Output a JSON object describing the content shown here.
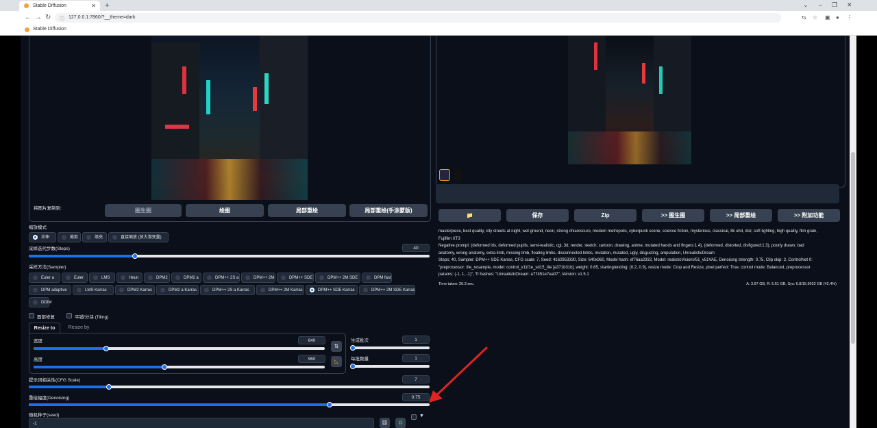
{
  "browser": {
    "tab_title": "Stable Diffusion",
    "url": "127.0.0.1:7860/?__theme=dark",
    "bookmark": "Stable Diffusion"
  },
  "left": {
    "paste_label": "将图片复制到:",
    "copy_buttons": [
      "图生图",
      "绘图",
      "局部重绘",
      "局部重绘(手涂蒙版)"
    ],
    "resize_mode_label": "缩放模式",
    "resize_modes": [
      "拉伸",
      "裁剪",
      "填充",
      "直接缩放 (放大潜变量)"
    ],
    "steps_label": "采样迭代步数(Steps)",
    "steps": "40",
    "sampler_label": "采样方法(Sampler)",
    "samplers_row1": [
      "Euler a",
      "Euler",
      "LMS",
      "Heun",
      "DPM2",
      "DPM2 a",
      "DPM++ 2S a",
      "DPM++ 2M",
      "DPM++ SDE",
      "DPM++ 2M SDE",
      "DPM fast"
    ],
    "samplers_row2": [
      "DPM adaptive",
      "LMS Karras",
      "DPM2 Karras",
      "DPM2 a Karras",
      "DPM++ 2S a Karras",
      "DPM++ 2M Karras",
      "DPM++ SDE Karras",
      "DPM++ 2M SDE Karras"
    ],
    "samplers_row3": [
      "DDIM"
    ],
    "selected_sampler": "DPM++ SDE Karras",
    "face_restore": "面部修复",
    "tiling": "平铺/分块 (Tiling)",
    "tab_resize_to": "Resize to",
    "tab_resize_by": "Resize by",
    "width_label": "宽度",
    "width": "640",
    "height_label": "高度",
    "height": "960",
    "batch_count_label": "生成批次",
    "batch_count": "1",
    "batch_size_label": "每批数量",
    "batch_size": "1",
    "cfg_label": "提示词相关性(CFG Scale)",
    "cfg": "7",
    "denoise_label": "重绘幅度(Denoising)",
    "denoise": "0.75",
    "seed_label": "随机种子(seed)",
    "seed": "-1",
    "steps_level": 0.265,
    "width_level": 0.25,
    "height_level": 0.45,
    "cfg_level": 0.2,
    "denoise_level": 0.75
  },
  "right": {
    "buttons": [
      "📁",
      "保存",
      "Zip",
      ">> 图生图",
      ">> 局部重绘",
      ">> 附加功能"
    ],
    "info_lines": [
      "masterpiece, best quality, city streets at night, wet ground, neon, strong chiaroscuro, modern metropolis, cyberpunk scene, science fiction, mysterious, classical, 8k uhd, dslr, soft lighting, high quality, film grain,",
      "Fujifilm XT3",
      "Negative prompt: (deformed iris, deformed pupils, semi-realistic, cgi, 3d, render, sketch, cartoon, drawing, anime, mutated hands and fingers:1.4), (deformed, distorted, disfigured:1.3), poorly drawn, bad",
      "anatomy, wrong anatomy, extra limb, missing limb, floating limbs, disconnected limbs, mutation, mutated, ugly, disgusting, amputation, UnrealisticDream",
      "Steps: 40, Sampler: DPM++ SDE Karras, CFG scale: 7, Seed: 4162953330, Size: 640x960, Model hash: ef76aa2332, Model: realisticVisionV51_v51VAE, Denoising strength: 0.75, Clip skip: 2, ControlNet 0:",
      "\"preprocessor: tile_resample, model: control_v11f1e_sd15_tile [a371b31b], weight: 0.65, starting/ending: (0.2, 0.9), resize mode: Crop and Resize, pixel perfect: True, control mode: Balanced, preprocessor",
      "params: (-1, 1, -1)\", TI hashes: \"UnrealisticDream: a77451e7ea07\", Version: v1.5.1"
    ],
    "time_taken": "Time taken: 20.3 sec.",
    "memory": "A: 3.97 GB, R: 5.61 GB, Sys: 6.8/15.9922 GB (42.4%)"
  },
  "colors": {
    "accent": "#1d6fea",
    "arrow": "#e02424",
    "background": "#0b0f19"
  }
}
